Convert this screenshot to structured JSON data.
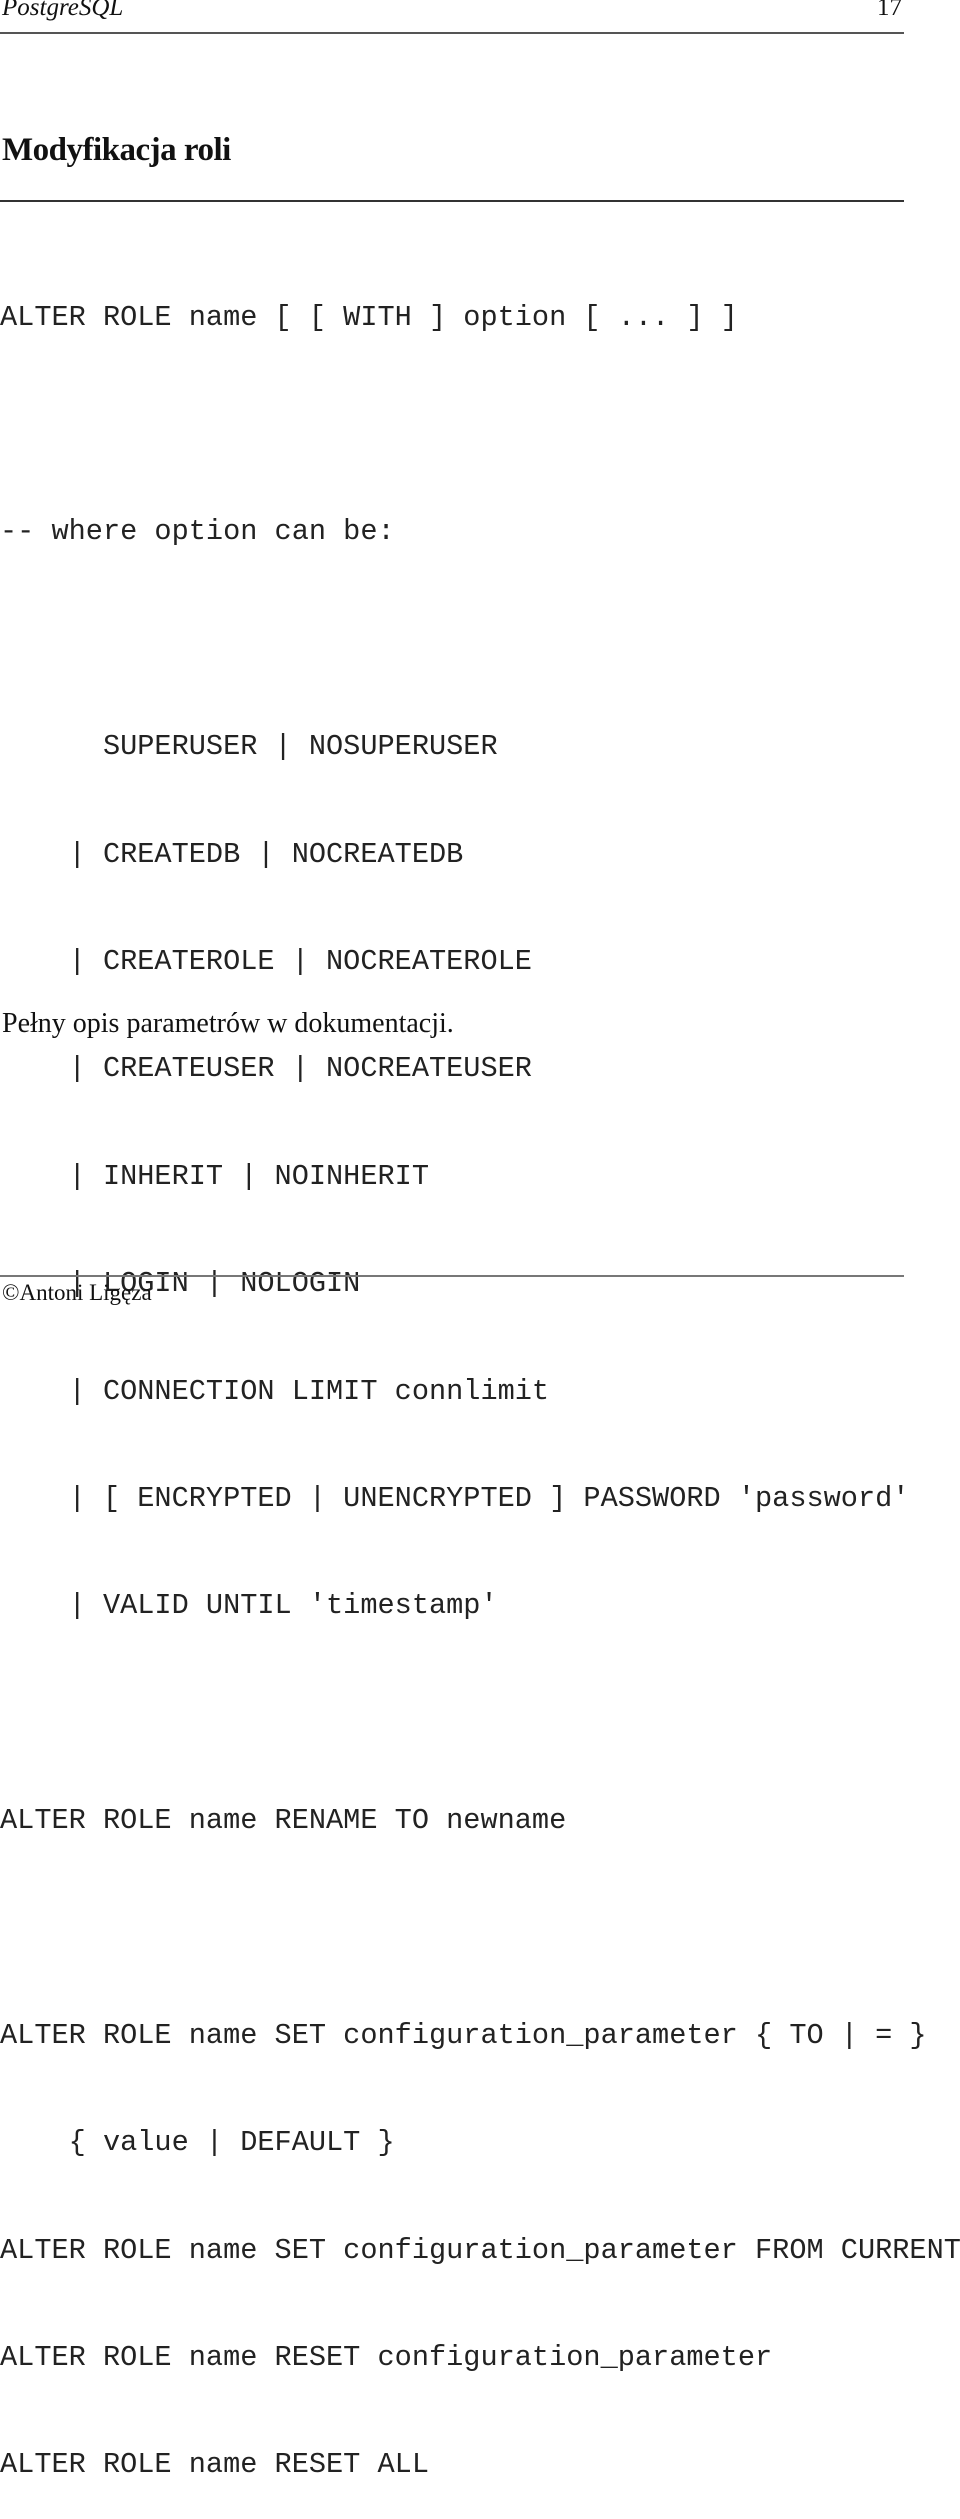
{
  "header": {
    "title": "PostgreSQL",
    "page_number": "17"
  },
  "slide": {
    "title": "Modyfikacja roli",
    "block1": [
      "ALTER ROLE name [ [ WITH ] option [ ... ] ]",
      "",
      "-- where option can be:",
      "",
      "      SUPERUSER | NOSUPERUSER",
      "    | CREATEDB | NOCREATEDB",
      "    | CREATEROLE | NOCREATEROLE",
      "    | CREATEUSER | NOCREATEUSER",
      "    | INHERIT | NOINHERIT",
      "    | LOGIN | NOLOGIN",
      "    | CONNECTION LIMIT connlimit",
      "    | [ ENCRYPTED | UNENCRYPTED ] PASSWORD 'password'",
      "    | VALID UNTIL 'timestamp'",
      "",
      "ALTER ROLE name RENAME TO newname",
      "",
      "ALTER ROLE name SET configuration_parameter { TO | = }",
      "    { value | DEFAULT }",
      "ALTER ROLE name SET configuration_parameter FROM CURRENT",
      "ALTER ROLE name RESET configuration_parameter",
      "ALTER ROLE name RESET ALL"
    ],
    "note": "Pełny opis parametrów w dokumentacji."
  },
  "footer": {
    "copyright": "©Antoni Ligęza"
  }
}
